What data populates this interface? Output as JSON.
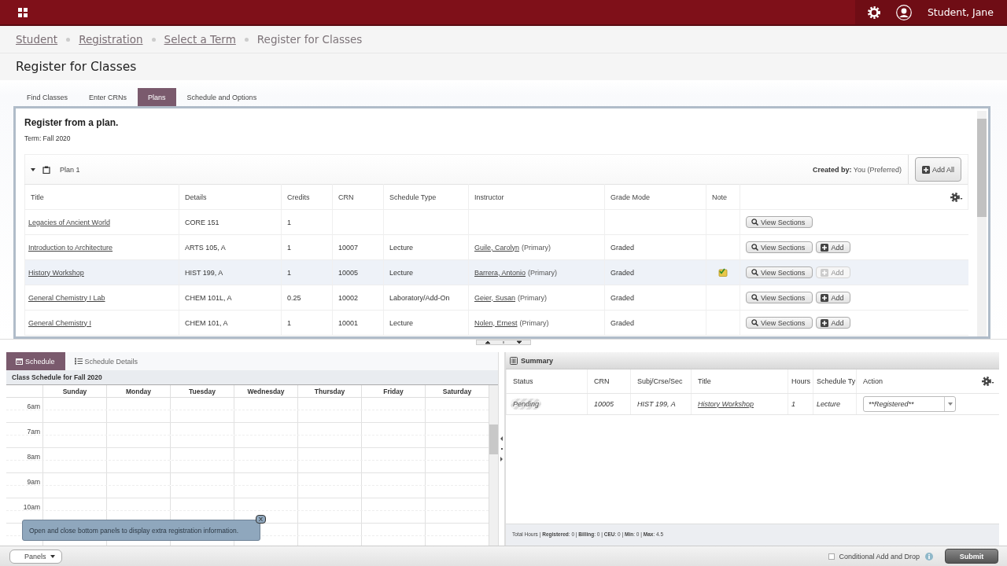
{
  "top_bar": {
    "user_name": "Student, Jane"
  },
  "breadcrumbs": [
    {
      "label": "Student",
      "link": true
    },
    {
      "label": "Registration",
      "link": true
    },
    {
      "label": "Select a Term",
      "link": true
    },
    {
      "label": "Register for Classes",
      "link": false
    }
  ],
  "page_title": "Register for Classes",
  "tabs": [
    {
      "label": "Find Classes",
      "selected": false
    },
    {
      "label": "Enter CRNs",
      "selected": false
    },
    {
      "label": "Plans",
      "selected": true
    },
    {
      "label": "Schedule and Options",
      "selected": false
    }
  ],
  "plan_panel": {
    "heading": "Register from a plan.",
    "term": "Term: Fall 2020",
    "plan": {
      "name": "Plan 1",
      "expanded": true,
      "created_by": "**Created by:** You (Preferred)",
      "add_all": "Add All"
    },
    "columns": [
      "Title",
      "Details",
      "Credits",
      "CRN",
      "Schedule Type",
      "Instructor",
      "Grade Mode",
      "Note"
    ],
    "rows": [
      {
        "title": "Legacies of Ancient World",
        "details": "CORE 151",
        "credits": "1",
        "note": false,
        "selected": false,
        "view": "View Sections"
      },
      {
        "title": "Introduction to Architecture",
        "details": "ARTS 105, A",
        "credits": "1",
        "crn": "10007",
        "schedule_type": "Lecture",
        "instructor": "Guile, Carolyn",
        "instructor_role": "(Primary)",
        "grade_mode": "Graded",
        "note": false,
        "selected": false,
        "view": "View Sections",
        "add": {
          "label": "Add",
          "disabled": false
        }
      },
      {
        "title": "History Workshop",
        "details": "HIST 199, A",
        "credits": "1",
        "crn": "10005",
        "schedule_type": "Lecture",
        "instructor": "Barrera, Antonio",
        "instructor_role": "(Primary)",
        "grade_mode": "Graded",
        "note": true,
        "selected": true,
        "view": "View Sections",
        "add": {
          "label": "Add",
          "disabled": true
        }
      },
      {
        "title": "General Chemistry I Lab",
        "details": "CHEM 101L, A",
        "credits": "0.25",
        "crn": "10002",
        "schedule_type": "Laboratory/Add-On",
        "instructor": "Geier, Susan",
        "instructor_role": "(Primary)",
        "grade_mode": "Graded",
        "note": false,
        "selected": false,
        "view": "View Sections",
        "add": {
          "label": "Add",
          "disabled": false
        }
      },
      {
        "title": "General Chemistry I",
        "details": "CHEM 101, A",
        "credits": "1",
        "crn": "10001",
        "schedule_type": "Lecture",
        "instructor": "Nolen, Ernest",
        "instructor_role": "(Primary)",
        "grade_mode": "Graded",
        "note": false,
        "selected": false,
        "view": "View Sections",
        "add": {
          "label": "Add",
          "disabled": false
        }
      }
    ]
  },
  "schedule_panel": {
    "tabs": [
      {
        "kind": "schedule",
        "label": "Schedule",
        "selected": true
      },
      {
        "kind": "details",
        "label": "Schedule Details",
        "selected": false
      }
    ],
    "caption": "Class Schedule for Fall 2020",
    "days": [
      "Sunday",
      "Monday",
      "Tuesday",
      "Wednesday",
      "Thursday",
      "Friday",
      "Saturday"
    ],
    "hours": [
      "6am",
      "7am",
      "8am",
      "9am",
      "10am"
    ],
    "tooltip": {
      "text": "Open and close bottom panels to display extra registration information.",
      "close": "X"
    }
  },
  "summary_panel": {
    "title": "Summary",
    "columns": [
      "Status",
      "CRN",
      "Subj/Crse/Sec",
      "Title",
      "Hours",
      "Schedule Ty",
      "Action"
    ],
    "rows": [
      {
        "status": "Pending",
        "crn": "10005",
        "subj": "HIST 199, A",
        "title": "History Workshop",
        "hours": "1",
        "schedule_type": "Lecture",
        "action": "**Registered**"
      }
    ],
    "totals": "Total Hours | **Registered**: 0 | **Billing**: 0 | **CEU**: 0 | **Min**: 0 | **Max**: 4.5"
  },
  "footer": {
    "panels": "Panels",
    "conditional": {
      "label": "Conditional Add and Drop",
      "checked": false
    },
    "submit": "Submit"
  }
}
